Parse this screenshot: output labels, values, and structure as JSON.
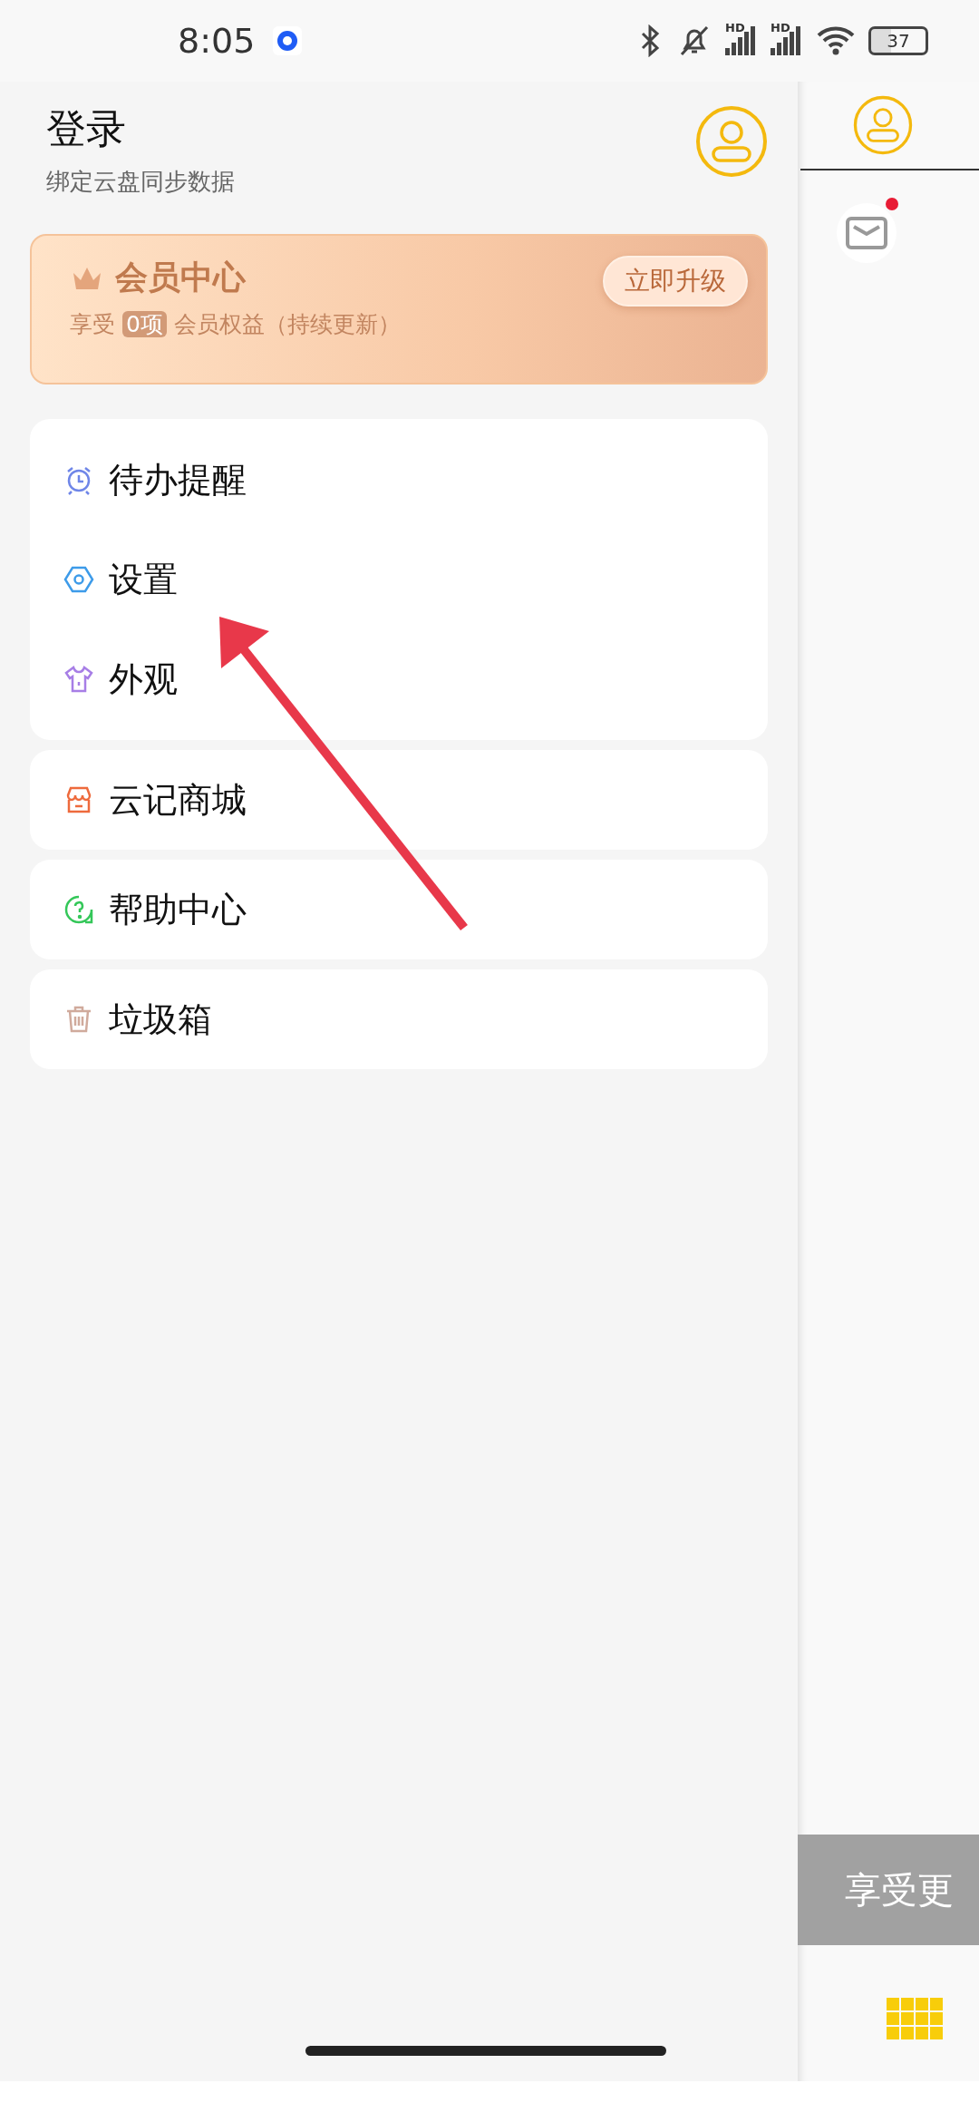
{
  "status_bar": {
    "time": "8:05",
    "signal_labels": [
      "HD",
      "HD"
    ],
    "battery": "37"
  },
  "drawer": {
    "title": "登录",
    "subtitle": "绑定云盘同步数据",
    "vip": {
      "title": "会员中心",
      "text_before": "享受",
      "count": "0项",
      "text_after": "会员权益（持续更新）",
      "button": "立即升级"
    },
    "groups": [
      {
        "items": [
          {
            "label": "待办提醒"
          },
          {
            "label": "设置"
          },
          {
            "label": "外观"
          }
        ]
      },
      {
        "items": [
          {
            "label": "云记商城"
          }
        ]
      },
      {
        "items": [
          {
            "label": "帮助中心"
          }
        ]
      },
      {
        "items": [
          {
            "label": "垃圾箱"
          }
        ]
      }
    ]
  },
  "right_panel": {
    "mail_unread": true,
    "banner": "享受更"
  }
}
